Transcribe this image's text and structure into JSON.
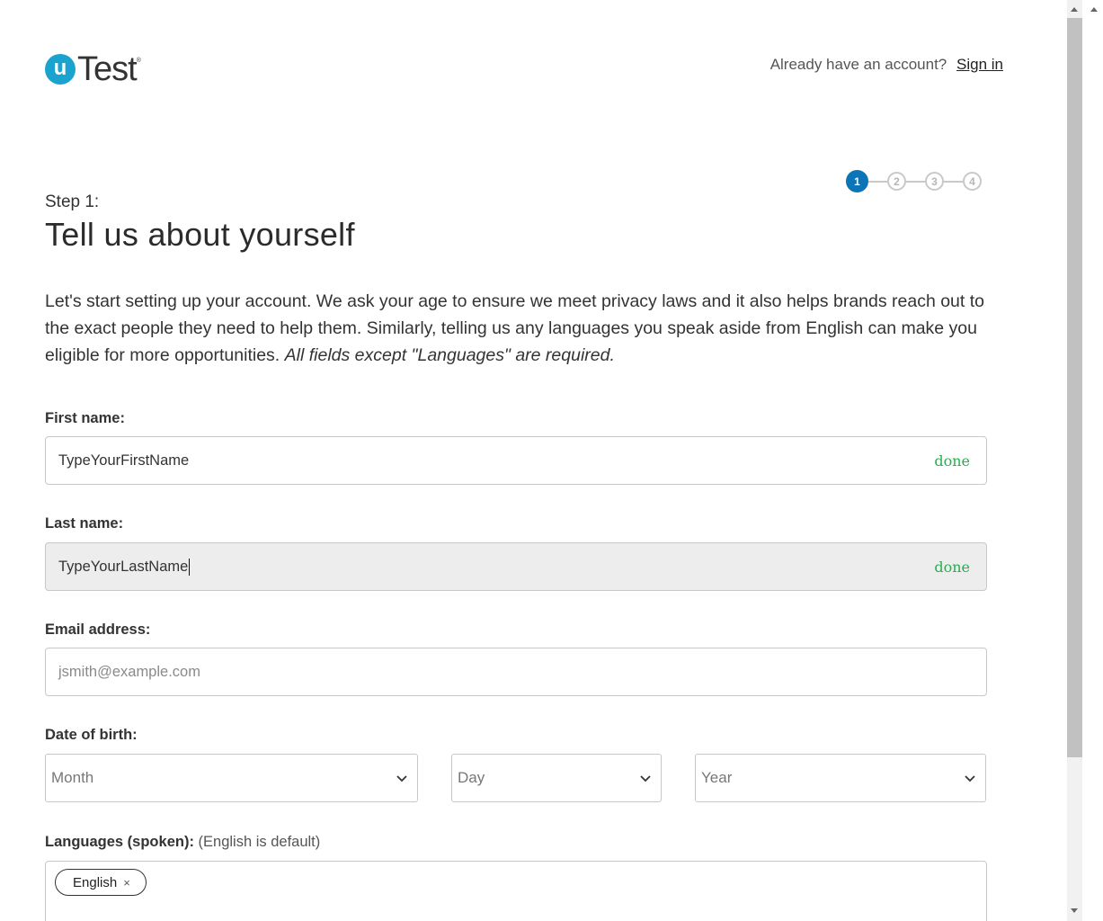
{
  "header": {
    "logo_letter": "u",
    "logo_text": "Test",
    "logo_mark": "®",
    "account_prompt": "Already have an account?",
    "signin_label": "Sign in"
  },
  "stepper": {
    "steps": [
      "1",
      "2",
      "3",
      "4"
    ],
    "active_step": 1,
    "active_color": "#0c75b8"
  },
  "step_label": "Step 1:",
  "title": "Tell us about yourself",
  "intro": {
    "text": "Let's start setting up your account. We ask your age to ensure we meet privacy laws and it also helps brands reach out to the exact people they need to help them. Similarly, telling us any languages you speak aside from English can make you eligible for more opportunities.",
    "italic": "All fields except \"Languages\" are required."
  },
  "form": {
    "first_name": {
      "label": "First name:",
      "value": "TypeYourFirstName",
      "status": "done"
    },
    "last_name": {
      "label": "Last name:",
      "value": "TypeYourLastName",
      "status": "done"
    },
    "email": {
      "label": "Email address:",
      "placeholder": "jsmith@example.com"
    },
    "dob": {
      "label": "Date of birth:",
      "month": "Month",
      "day": "Day",
      "year": "Year"
    },
    "languages": {
      "label": "Languages (spoken):",
      "hint": "(English is default)",
      "tags": [
        {
          "label": "English",
          "remove": "×"
        }
      ]
    }
  },
  "colors": {
    "brand": "#1aa3cf",
    "done": "#22b24c"
  },
  "icons": [
    "chevron-down-icon",
    "close-icon",
    "scroll-up-arrow-icon",
    "scroll-down-arrow-icon"
  ]
}
